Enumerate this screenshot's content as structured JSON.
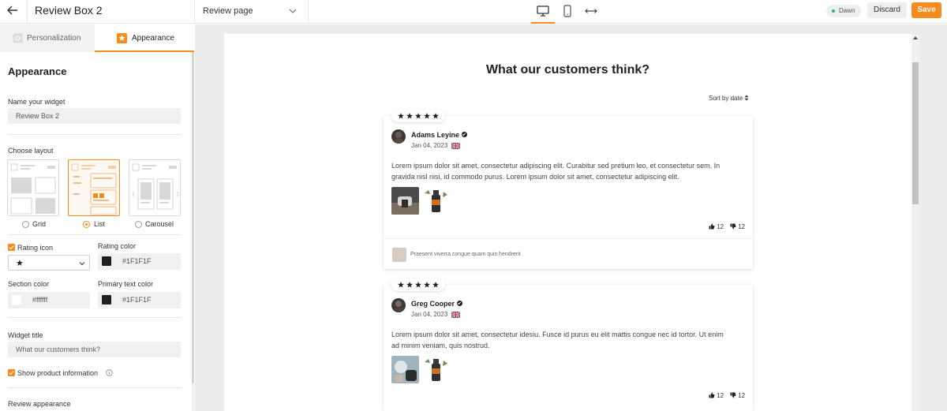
{
  "topbar": {
    "widget_name": "Review Box 2",
    "page_select": "Review page",
    "theme_badge": "Dawn",
    "discard_label": "Discard",
    "save_label": "Save"
  },
  "tabs": [
    {
      "label": "Personalization",
      "active": false
    },
    {
      "label": "Appearance",
      "active": true
    }
  ],
  "panel": {
    "heading": "Appearance",
    "name_label": "Name your widget",
    "name_value": "Review Box 2",
    "layout_label": "Choose layout",
    "layouts": [
      "Grid",
      "List",
      "Carousel"
    ],
    "selected_layout": "List",
    "rating_icon_label": "Rating icon",
    "rating_icon_checked": true,
    "rating_icon_value": "★",
    "rating_color_label": "Rating color",
    "rating_color": "#1F1F1F",
    "section_color_label": "Section color",
    "section_color": "#ffffff",
    "primary_text_label": "Primary text color",
    "primary_text_color": "#1F1F1F",
    "widget_title_label": "Widget title",
    "widget_title_placeholder": "What our customers think?",
    "show_product_label": "Show product information",
    "show_product_checked": true,
    "review_appearance_label": "Review appearance"
  },
  "preview": {
    "title": "What our customers think?",
    "sort_label": "Sort by date",
    "reviews": [
      {
        "name": "Adams Leyine",
        "date": "Jan 04, 2023",
        "rating": 5,
        "body_line1": "Lorem ipsum dolor sit amet, consectetur adipiscing elit. Curabitur sed pretium leo, et consectetur sem. In",
        "body_line2": "gravida nisl nisi, id commodo purus. Lorem ipsum dolor sit amet, consectetur adipiscing elit.",
        "likes": "12",
        "dislikes": "12",
        "reply": "Praesent viverra congue quam quis hendrerit"
      },
      {
        "name": "Greg Cooper",
        "date": "Jan 04, 2023",
        "rating": 5,
        "body_line1": "Lorem ipsum dolor sit amet, consectetur idesiu. Fusce id purus eu elit mattis congue nec id tortor. Ut enim",
        "body_line2": "ad minim veniam, quis nostrud.",
        "likes": "12",
        "dislikes": "12"
      }
    ]
  },
  "colors": {
    "accent": "#f68b1e",
    "text": "#1f1f1f",
    "canvas_bg": "#ececec"
  }
}
